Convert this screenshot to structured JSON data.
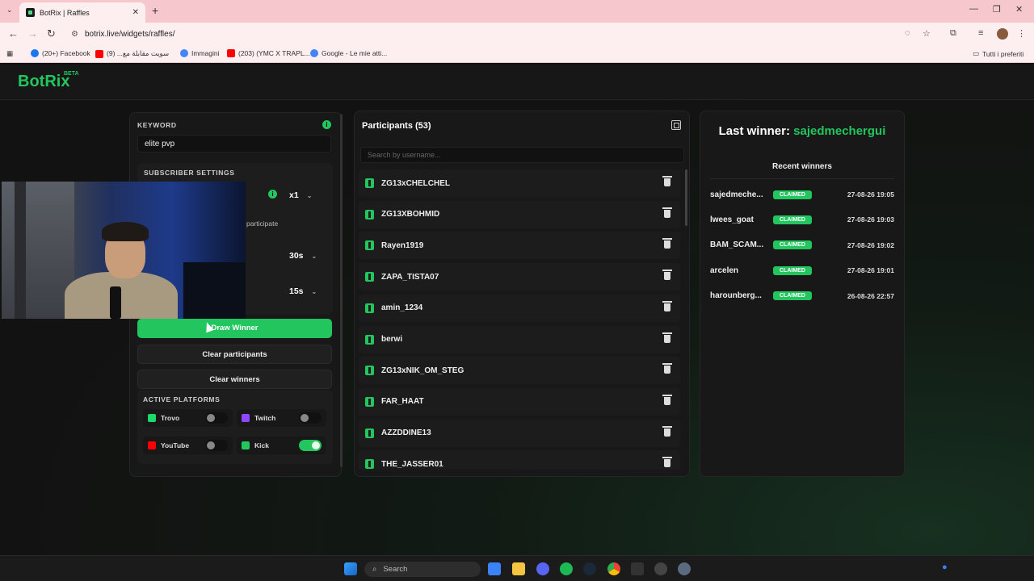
{
  "browser": {
    "tab_title": "BotRix | Raffles",
    "url": "botrix.live/widgets/raffles/",
    "bookmarks": [
      {
        "label": "(20+) Facebook",
        "color": "#1877f2"
      },
      {
        "label": "سويت مقابلة مع... (9)",
        "color": "#ff0000"
      },
      {
        "label": "Immagini",
        "color": "#4285f4"
      },
      {
        "label": "(203) (YMC X TRAPL...",
        "color": "#ff0000"
      },
      {
        "label": "Google - Le mie atti...",
        "color": "#4285f4"
      }
    ],
    "all_bookmarks": "Tutti i preferiti"
  },
  "app": {
    "logo": "BotRix",
    "logo_badge": "BETA",
    "accent": "#22c55e"
  },
  "settings": {
    "keyword_label": "KEYWORD",
    "keyword_value": "elite pvp",
    "subscriber_label": "SUBSCRIBER SETTINGS",
    "multiplier": "x1",
    "participate_text": "participate",
    "timer_1": "30s",
    "timer_2": "15s",
    "draw_winner": "Draw Winner",
    "clear_participants": "Clear participants",
    "clear_winners": "Clear winners",
    "active_platforms_label": "ACTIVE PLATFORMS",
    "platforms": [
      {
        "name": "Trovo",
        "enabled": false,
        "color": "#1bd96a"
      },
      {
        "name": "Twitch",
        "enabled": false,
        "color": "#9146ff"
      },
      {
        "name": "YouTube",
        "enabled": false,
        "color": "#ff0000"
      },
      {
        "name": "Kick",
        "enabled": true,
        "color": "#22c55e"
      }
    ]
  },
  "participants": {
    "title": "Participants (53)",
    "search_placeholder": "Search by username...",
    "items": [
      "ZG13xCHELCHEL",
      "ZG13XBOHMID",
      "Rayen1919",
      "ZAPA_TISTA07",
      "amin_1234",
      "berwi",
      "ZG13xNIK_OM_STEG",
      "FAR_HAAT",
      "AZZDDINE13",
      "THE_JASSER01"
    ]
  },
  "winners": {
    "last_winner_label": "Last winner:",
    "last_winner_name": "sajedmechergui",
    "recent_title": "Recent winners",
    "claimed_label": "CLAIMED",
    "items": [
      {
        "name": "sajedmeche...",
        "date": "27-08-26 19:05"
      },
      {
        "name": "lwees_goat",
        "date": "27-08-26 19:03"
      },
      {
        "name": "BAM_SCAM...",
        "date": "27-08-26 19:02"
      },
      {
        "name": "arcelen",
        "date": "27-08-26 19:01"
      },
      {
        "name": "harounberg...",
        "date": "26-08-26 22:57"
      }
    ]
  },
  "taskbar": {
    "search_label": "Search"
  }
}
